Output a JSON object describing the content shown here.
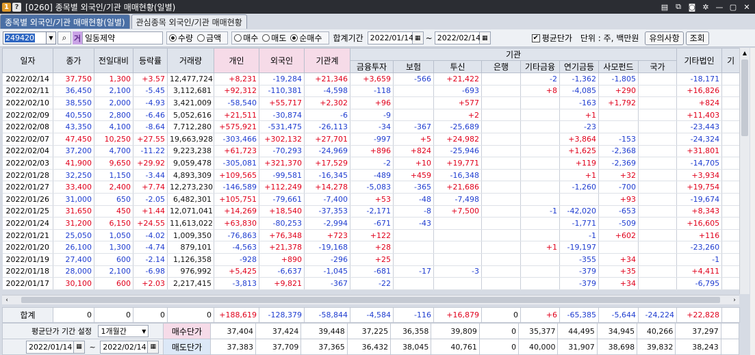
{
  "window": {
    "badge1": "1",
    "badge2": "?",
    "title": "[0260] 종목별 외국인/기관 매매현황(일별)",
    "icons": [
      "layout-icon",
      "copy-icon",
      "camera-icon",
      "settings-icon",
      "minimize-icon",
      "restore-icon",
      "close-icon"
    ]
  },
  "tabs": [
    {
      "label": "종목별 외국인/기관 매매현황(일별)",
      "active": true
    },
    {
      "label": "관심종목 외국인/기관 매매현황",
      "active": false
    }
  ],
  "toolbar": {
    "code": "249420",
    "market_badge": "거",
    "stock_name": "일동제약",
    "radio_group1": [
      {
        "label": "수량",
        "checked": true
      },
      {
        "label": "금액",
        "checked": false
      }
    ],
    "radio_group2": [
      {
        "label": "매수",
        "checked": false
      },
      {
        "label": "매도",
        "checked": false
      },
      {
        "label": "순매수",
        "checked": true
      }
    ],
    "period_label": "합계기간",
    "date_from": "2022/01/14",
    "tilde": "~",
    "date_to": "2022/02/14",
    "avg_price_checkbox": "평균단가",
    "unit_label": "단위 : 주, 백만원",
    "notice_button": "유의사항",
    "query_button": "조회"
  },
  "grid": {
    "header_group": "기관",
    "columns": [
      "일자",
      "종가",
      "전일대비",
      "등락률",
      "거래량",
      "개인",
      "외국인",
      "기관계",
      "금융투자",
      "보험",
      "투신",
      "은행",
      "기타금융",
      "연기금등",
      "사모펀드",
      "국가",
      "기타법인",
      "기"
    ],
    "rows": [
      [
        "2022/02/14",
        "37,750",
        "1,300",
        "+3.57",
        "12,477,724",
        "+8,231",
        "-19,284",
        "+21,346",
        "+3,659",
        "-566",
        "+21,422",
        "",
        "-2",
        "-1,362",
        "-1,805",
        "",
        "-18,171",
        ""
      ],
      [
        "2022/02/11",
        "36,450",
        "2,100",
        "-5.45",
        "3,112,681",
        "+92,312",
        "-110,381",
        "-4,598",
        "-118",
        "",
        "-693",
        "",
        "+8",
        "-4,085",
        "+290",
        "",
        "+16,826",
        ""
      ],
      [
        "2022/02/10",
        "38,550",
        "2,000",
        "-4.93",
        "3,421,009",
        "-58,540",
        "+55,717",
        "+2,302",
        "+96",
        "",
        "+577",
        "",
        "",
        "-163",
        "+1,792",
        "",
        "+824",
        ""
      ],
      [
        "2022/02/09",
        "40,550",
        "2,800",
        "-6.46",
        "5,052,616",
        "+21,511",
        "-30,874",
        "-6",
        "-9",
        "",
        "+2",
        "",
        "",
        "+1",
        "",
        "",
        "+11,403",
        ""
      ],
      [
        "2022/02/08",
        "43,350",
        "4,100",
        "-8.64",
        "7,712,280",
        "+575,921",
        "-531,475",
        "-26,113",
        "-34",
        "-367",
        "-25,689",
        "",
        "",
        "-23",
        "",
        "",
        "-23,443",
        ""
      ],
      [
        "2022/02/07",
        "47,450",
        "10,250",
        "+27.55",
        "19,663,928",
        "-303,466",
        "+302,132",
        "+27,701",
        "-997",
        "+5",
        "+24,982",
        "",
        "",
        "+3,864",
        "-153",
        "",
        "-24,324",
        ""
      ],
      [
        "2022/02/04",
        "37,200",
        "4,700",
        "-11.22",
        "9,223,238",
        "+61,723",
        "-70,293",
        "-24,969",
        "+896",
        "+824",
        "-25,946",
        "",
        "",
        "+1,625",
        "-2,368",
        "",
        "+31,801",
        ""
      ],
      [
        "2022/02/03",
        "41,900",
        "9,650",
        "+29.92",
        "9,059,478",
        "-305,081",
        "+321,370",
        "+17,529",
        "-2",
        "+10",
        "+19,771",
        "",
        "",
        "+119",
        "-2,369",
        "",
        "-14,705",
        ""
      ],
      [
        "2022/01/28",
        "32,250",
        "1,150",
        "-3.44",
        "4,893,309",
        "+109,565",
        "-99,581",
        "-16,345",
        "-489",
        "+459",
        "-16,348",
        "",
        "",
        "+1",
        "+32",
        "",
        "+3,934",
        ""
      ],
      [
        "2022/01/27",
        "33,400",
        "2,400",
        "+7.74",
        "12,273,230",
        "-146,589",
        "+112,249",
        "+14,278",
        "-5,083",
        "-365",
        "+21,686",
        "",
        "",
        "-1,260",
        "-700",
        "",
        "+19,754",
        ""
      ],
      [
        "2022/01/26",
        "31,000",
        "650",
        "-2.05",
        "6,482,301",
        "+105,751",
        "-79,661",
        "-7,400",
        "+53",
        "-48",
        "-7,498",
        "",
        "",
        "",
        "+93",
        "",
        "-19,674",
        ""
      ],
      [
        "2022/01/25",
        "31,650",
        "450",
        "+1.44",
        "12,071,041",
        "+14,269",
        "+18,540",
        "-37,353",
        "-2,171",
        "-8",
        "+7,500",
        "",
        "-1",
        "-42,020",
        "-653",
        "",
        "+8,343",
        ""
      ],
      [
        "2022/01/24",
        "31,200",
        "6,150",
        "+24.55",
        "11,613,022",
        "+63,830",
        "-80,253",
        "-2,994",
        "-671",
        "-43",
        "",
        "",
        "",
        "-1,771",
        "-509",
        "",
        "+16,605",
        ""
      ],
      [
        "2022/01/21",
        "25,050",
        "1,050",
        "-4.02",
        "1,009,350",
        "-76,863",
        "+76,348",
        "+723",
        "+122",
        "",
        "",
        "",
        "",
        "-1",
        "+602",
        "",
        "+116",
        ""
      ],
      [
        "2022/01/20",
        "26,100",
        "1,300",
        "-4.74",
        "879,101",
        "-4,563",
        "+21,378",
        "-19,168",
        "+28",
        "",
        "",
        "",
        "+1",
        "-19,197",
        "",
        "",
        "-23,260",
        ""
      ],
      [
        "2022/01/19",
        "27,400",
        "600",
        "-2.14",
        "1,126,358",
        "-928",
        "+890",
        "-296",
        "+25",
        "",
        "",
        "",
        "",
        "-355",
        "+34",
        "",
        "-1",
        ""
      ],
      [
        "2022/01/18",
        "28,000",
        "2,100",
        "-6.98",
        "976,992",
        "+5,425",
        "-6,637",
        "-1,045",
        "-681",
        "-17",
        "-3",
        "",
        "",
        "-379",
        "+35",
        "",
        "+4,411",
        ""
      ],
      [
        "2022/01/17",
        "30,100",
        "600",
        "+2.03",
        "2,217,415",
        "-3,813",
        "+9,821",
        "-367",
        "-22",
        "",
        "",
        "",
        "",
        "-379",
        "+34",
        "",
        "-6,795",
        ""
      ]
    ]
  },
  "totals": {
    "label": "합계",
    "values": [
      "0",
      "0",
      "0",
      "0",
      "+188,619",
      "-128,379",
      "-58,844",
      "-4,584",
      "-116",
      "+16,879",
      "0",
      "+6",
      "-65,385",
      "-5,644",
      "-24,224",
      "+22,828"
    ]
  },
  "avg": {
    "setting_label": "평균단가 기간 설정",
    "period_select": "1개월간",
    "date_from": "2022/01/14",
    "date_to": "2022/02/14",
    "buy_label": "매수단가",
    "sell_label": "매도단가",
    "buy_values": [
      "37,404",
      "37,424",
      "39,448",
      "37,225",
      "36,358",
      "39,809",
      "0",
      "35,377",
      "44,495",
      "34,945",
      "40,266",
      "37,297"
    ],
    "sell_values": [
      "37,383",
      "37,709",
      "37,365",
      "36,432",
      "38,045",
      "40,761",
      "0",
      "40,000",
      "31,907",
      "38,698",
      "39,832",
      "38,243"
    ]
  },
  "colors": {
    "up": "#e0001b",
    "down": "#1f3dd0",
    "active_tab": "#4a6fa5",
    "pink_header": "#f6dbe8"
  }
}
